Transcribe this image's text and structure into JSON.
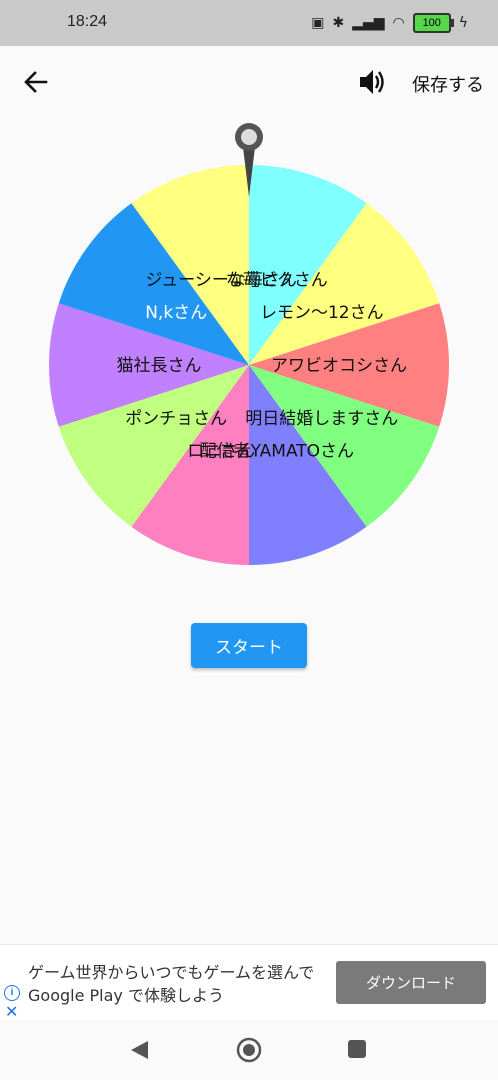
{
  "status_bar": {
    "time": "18:24",
    "battery": "100"
  },
  "app_bar": {
    "save_label": "保存する"
  },
  "wheel": {
    "segments": [
      {
        "label": "な苺ピクさん",
        "color": "#80ffff"
      },
      {
        "label": "レモン〜12さん",
        "color": "#ffff80"
      },
      {
        "label": "アワビオコシさん",
        "color": "#ff8080"
      },
      {
        "label": "明日結婚しますさん",
        "color": "#80ff80"
      },
      {
        "label": "配信者YAMATOさん",
        "color": "#8080ff"
      },
      {
        "label": "ロニさん",
        "color": "#ff80c0"
      },
      {
        "label": "ポンチョさん",
        "color": "#c0ff80"
      },
      {
        "label": "猫社長さん",
        "color": "#c080ff"
      },
      {
        "label": "N,kさん",
        "color": "#2196f3"
      },
      {
        "label": "ジューシーな苺さん",
        "color": "#ffff80"
      }
    ]
  },
  "start_button": {
    "label": "スタート"
  },
  "ad": {
    "text": "ゲーム世界からいつでもゲームを選んで Google Play で体験しよう",
    "download_label": "ダウンロード"
  }
}
